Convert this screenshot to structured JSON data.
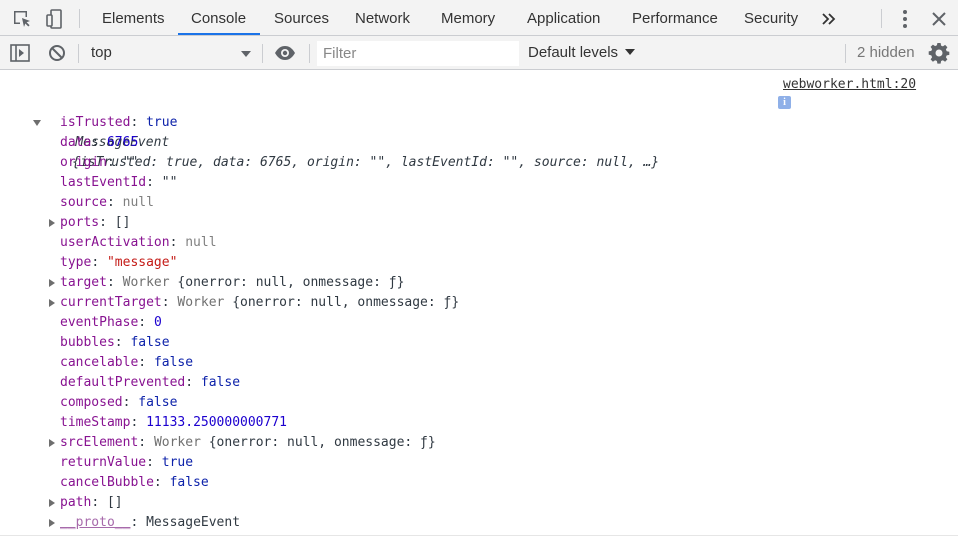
{
  "tabs": [
    "Elements",
    "Console",
    "Sources",
    "Network",
    "Memory",
    "Application",
    "Performance",
    "Security"
  ],
  "active_tab": "Console",
  "toolbar": {
    "context": "top",
    "filter_placeholder": "Filter",
    "levels_label": "Default levels",
    "hidden_count": "2 hidden"
  },
  "log": {
    "source": "webworker.html:20",
    "class_name": "MessageEvent",
    "summary": "{isTrusted: true, data: 6765, origin: \"\", lastEventId: \"\", source: null, …}",
    "info_glyph": "i",
    "properties": [
      {
        "key": "isTrusted",
        "value": "true",
        "type": "bool",
        "expandable": false
      },
      {
        "key": "data",
        "value": "6765",
        "type": "num",
        "expandable": false
      },
      {
        "key": "origin",
        "value": "\"\"",
        "type": "obj",
        "expandable": false
      },
      {
        "key": "lastEventId",
        "value": "\"\"",
        "type": "obj",
        "expandable": false
      },
      {
        "key": "source",
        "value": "null",
        "type": "null",
        "expandable": false
      },
      {
        "key": "ports",
        "value": "[]",
        "type": "obj",
        "expandable": true
      },
      {
        "key": "userActivation",
        "value": "null",
        "type": "null",
        "expandable": false
      },
      {
        "key": "type",
        "value": "\"message\"",
        "type": "str",
        "expandable": false
      },
      {
        "key": "target",
        "class": "Worker",
        "value": "{onerror: null, onmessage: ƒ}",
        "type": "class",
        "expandable": true
      },
      {
        "key": "currentTarget",
        "class": "Worker",
        "value": "{onerror: null, onmessage: ƒ}",
        "type": "class",
        "expandable": true
      },
      {
        "key": "eventPhase",
        "value": "0",
        "type": "num",
        "expandable": false
      },
      {
        "key": "bubbles",
        "value": "false",
        "type": "bool",
        "expandable": false
      },
      {
        "key": "cancelable",
        "value": "false",
        "type": "bool",
        "expandable": false
      },
      {
        "key": "defaultPrevented",
        "value": "false",
        "type": "bool",
        "expandable": false
      },
      {
        "key": "composed",
        "value": "false",
        "type": "bool",
        "expandable": false
      },
      {
        "key": "timeStamp",
        "value": "11133.250000000771",
        "type": "num",
        "expandable": false
      },
      {
        "key": "srcElement",
        "class": "Worker",
        "value": "{onerror: null, onmessage: ƒ}",
        "type": "class",
        "expandable": true
      },
      {
        "key": "returnValue",
        "value": "true",
        "type": "bool",
        "expandable": false
      },
      {
        "key": "cancelBubble",
        "value": "false",
        "type": "bool",
        "expandable": false
      },
      {
        "key": "path",
        "value": "[]",
        "type": "obj",
        "expandable": true
      },
      {
        "key": "__proto__",
        "value": "MessageEvent",
        "type": "obj",
        "expandable": true,
        "proto": true
      }
    ]
  }
}
